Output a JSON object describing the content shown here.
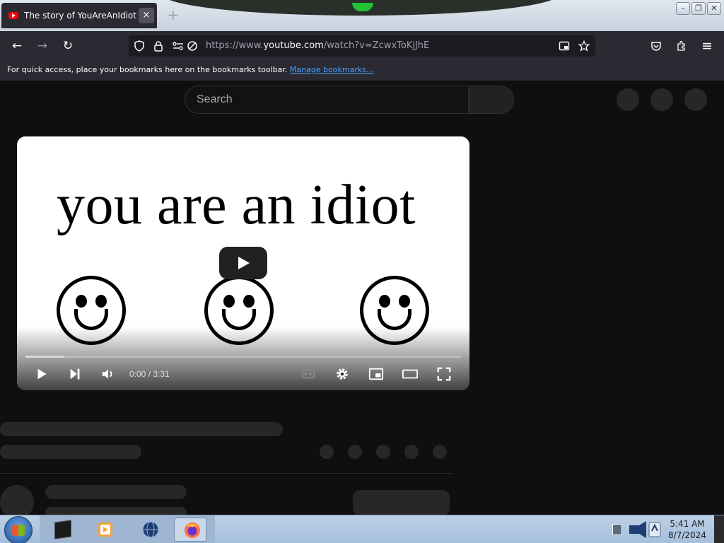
{
  "browser": {
    "tab": {
      "title": "The story of YouAreAnIdiot - YouTube",
      "close_glyph": "×"
    },
    "new_tab_glyph": "+",
    "window_buttons": {
      "minimize": "–",
      "maximize": "❐",
      "close": "✕"
    },
    "nav": {
      "back": "←",
      "forward": "→",
      "reload": "↻"
    },
    "url": {
      "prefix": "https://www.",
      "domain": "youtube.com",
      "path": "/watch?v=ZcwxToKjJhE"
    },
    "menu_glyph": "≡",
    "bookmarks_bar": {
      "message": "For quick access, place your bookmarks here on the bookmarks toolbar.",
      "link": "Manage bookmarks…"
    }
  },
  "youtube": {
    "search_placeholder": "Search",
    "video": {
      "frame_text": "you are an idiot",
      "time": "0:00 / 3:31",
      "load_progress": 0.09
    }
  },
  "taskbar": {
    "clock_time": "5:41 AM",
    "clock_date": "8/7/2024"
  },
  "colors": {
    "youtube_bg": "#0f0f0f",
    "firefox_toolbar": "#2b2a33",
    "link": "#45a1ff",
    "youtube_red": "#ff0000"
  }
}
